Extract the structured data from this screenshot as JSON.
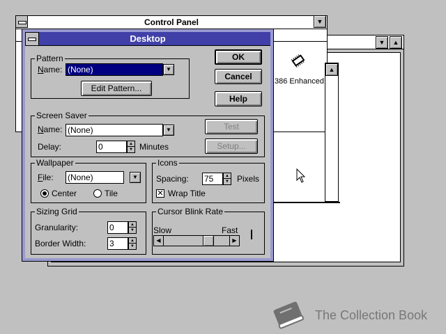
{
  "control_panel": {
    "title": "Control Panel",
    "icon_label": "386 Enhanced"
  },
  "dialog": {
    "title": "Desktop",
    "buttons": {
      "ok": "OK",
      "cancel": "Cancel",
      "help": "Help"
    },
    "pattern": {
      "group_label": "Pattern",
      "name_label": "Name:",
      "name_value": "(None)",
      "edit_button": "Edit Pattern..."
    },
    "screen_saver": {
      "group_label": "Screen Saver",
      "name_label": "Name:",
      "name_value": "(None)",
      "delay_label": "Delay:",
      "delay_value": "0",
      "delay_unit": "Minutes",
      "test_button": "Test",
      "setup_button": "Setup..."
    },
    "wallpaper": {
      "group_label": "Wallpaper",
      "file_label": "File:",
      "file_value": "(None)",
      "center_label": "Center",
      "tile_label": "Tile",
      "selected": "Center"
    },
    "icons": {
      "group_label": "Icons",
      "spacing_label": "Spacing:",
      "spacing_value": "75",
      "spacing_unit": "Pixels",
      "wrap_title_label": "Wrap Title",
      "wrap_title_checked": true
    },
    "sizing_grid": {
      "group_label": "Sizing Grid",
      "granularity_label": "Granularity:",
      "granularity_value": "0",
      "border_width_label": "Border Width:",
      "border_width_value": "3"
    },
    "cursor_blink": {
      "group_label": "Cursor Blink Rate",
      "slow_label": "Slow",
      "fast_label": "Fast",
      "rate_fraction": 0.72
    }
  },
  "watermark": {
    "text": "The Collection Book"
  }
}
